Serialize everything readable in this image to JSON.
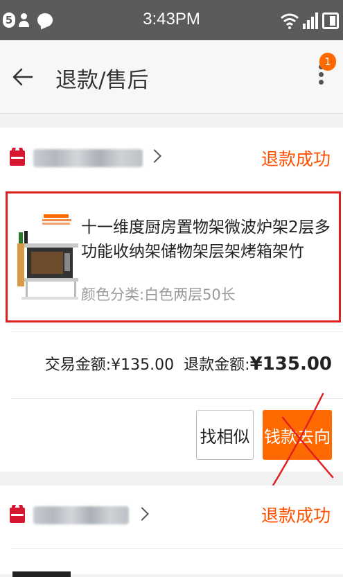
{
  "status_bar": {
    "notification_count": "5",
    "time": "3:43PM"
  },
  "header": {
    "title": "退款/售后",
    "badge_count": "1"
  },
  "orders": [
    {
      "shop_badge": "天猫",
      "status": "退款成功",
      "product_title": "十一维度厨房置物架微波炉架2层多功能收纳架储物架层架烤箱架竹",
      "sku": "颜色分类:白色两层50长",
      "trade_amount_label": "交易金额:",
      "trade_amount": "¥135.00",
      "refund_amount_label": "退款金额:",
      "refund_amount": "¥135.00",
      "btn_similar": "找相似",
      "btn_money": "钱款去向"
    },
    {
      "shop_badge": "天猫",
      "status": "退款成功"
    }
  ],
  "colors": {
    "accent": "#ff6a00",
    "status_text": "#ff5000",
    "status_bar": "#5b5b5b",
    "highlight_border": "#e02020",
    "tmall_red": "#d7172f"
  }
}
